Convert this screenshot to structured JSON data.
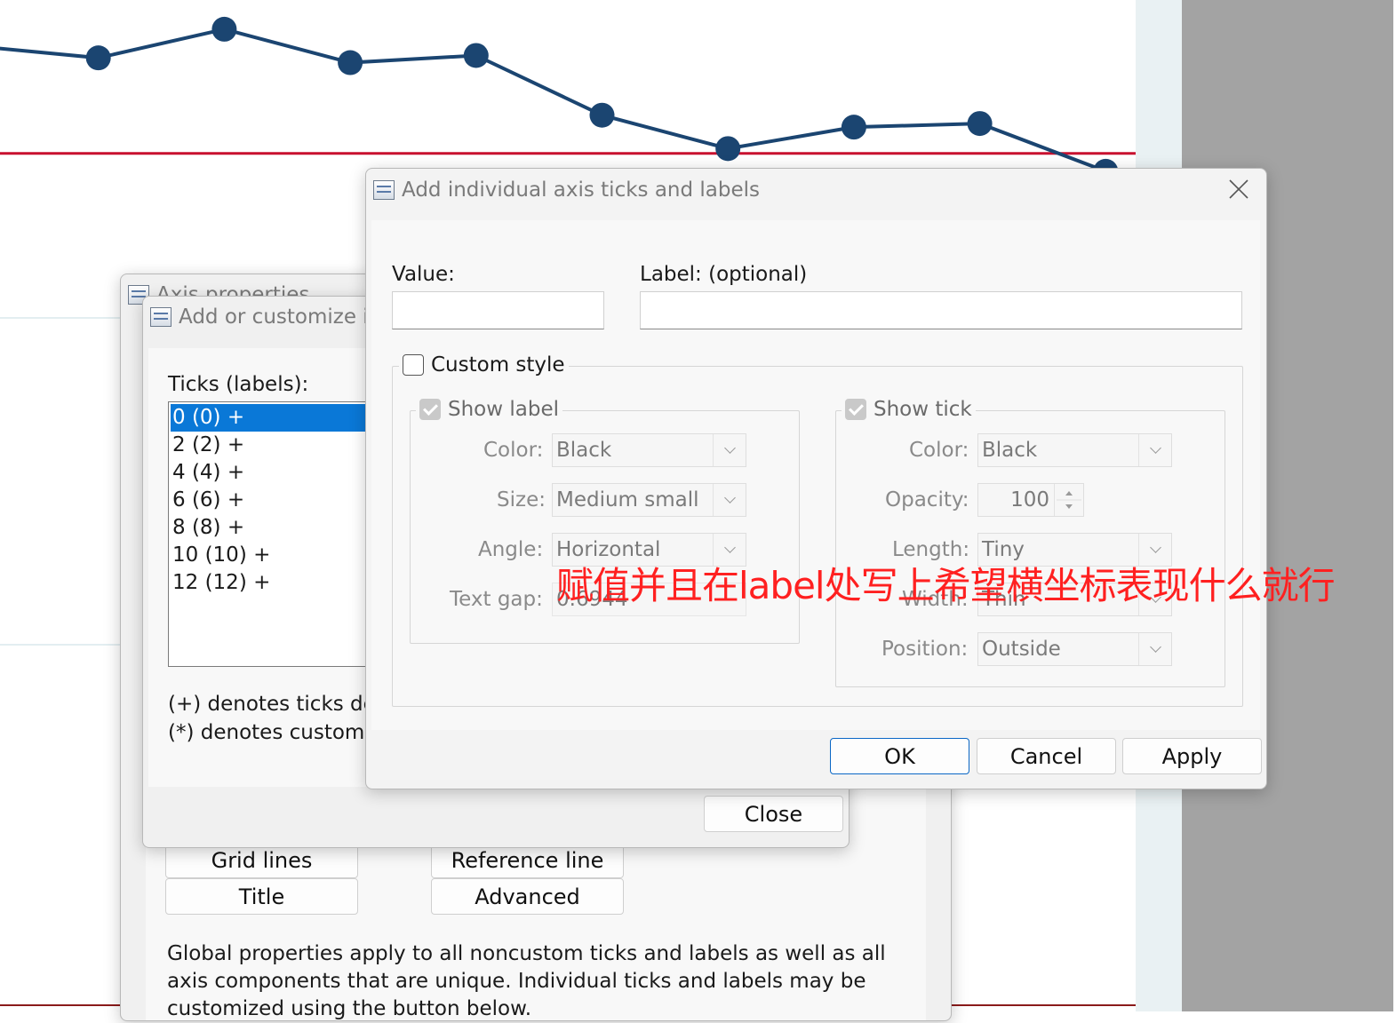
{
  "chart_data": {
    "type": "line",
    "points": [
      {
        "x": 0,
        "y": 1.1
      },
      {
        "x": 1,
        "y": 1.0
      },
      {
        "x": 2,
        "y": 1.24
      },
      {
        "x": 3,
        "y": 0.96
      },
      {
        "x": 4,
        "y": 1.02
      },
      {
        "x": 5,
        "y": 0.52
      },
      {
        "x": 6,
        "y": 0.24
      },
      {
        "x": 7,
        "y": 0.42
      },
      {
        "x": 8,
        "y": 0.45
      },
      {
        "x": 9,
        "y": 0.05
      }
    ],
    "reference_line_y": 0.2,
    "line_color": "#1b4571",
    "reference_color": "#c8102e"
  },
  "axis_window": {
    "title": "Axis properties",
    "buttons": {
      "grid_lines": "Grid lines",
      "reference_line": "Reference line",
      "title": "Title",
      "advanced": "Advanced"
    },
    "note": "Global properties apply to all noncustom ticks and labels as well as all axis components that are unique. Individual ticks and labels may be customized using the button below."
  },
  "ticks_window": {
    "title": "Add or customize individual ticks and labels",
    "list_label": "Ticks (labels):",
    "items": [
      "0 (0) +",
      "2 (2) +",
      "4 (4) +",
      "6 (6) +",
      "8 (8) +",
      "10 (10) +",
      "12 (12) +"
    ],
    "note_plus": "(+) denotes ticks defined by the global properties",
    "note_star": "(*) denotes custom ticks",
    "close_label": "Close"
  },
  "main_dialog": {
    "title": "Add individual axis ticks and labels",
    "value_label": "Value:",
    "value": "",
    "label_label": "Label: (optional)",
    "label_value": "",
    "custom_style": "Custom style",
    "show_label": "Show label",
    "show_tick": "Show tick",
    "label_fields": {
      "color_label": "Color:",
      "color": "Black",
      "size_label": "Size:",
      "size": "Medium small",
      "angle_label": "Angle:",
      "angle": "Horizontal",
      "gap_label": "Text gap:",
      "gap": "0.6944"
    },
    "tick_fields": {
      "color_label": "Color:",
      "color": "Black",
      "opacity_label": "Opacity:",
      "opacity": "100",
      "length_label": "Length:",
      "length": "Tiny",
      "width_label": "Width:",
      "width": "Thin",
      "position_label": "Position:",
      "position": "Outside"
    },
    "ok": "OK",
    "cancel": "Cancel",
    "apply": "Apply"
  },
  "annotation": "赋值并且在label处写上希望横坐标表现什么就行"
}
